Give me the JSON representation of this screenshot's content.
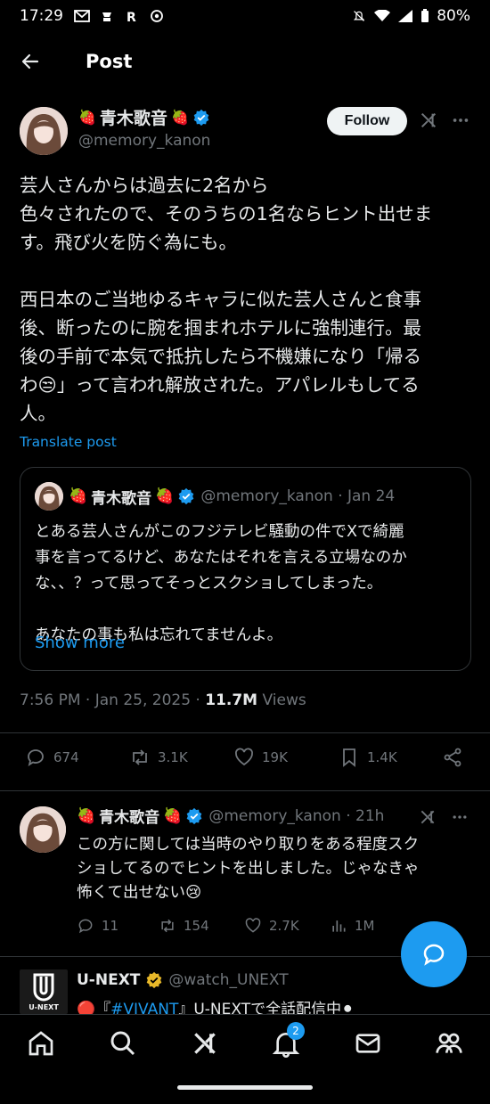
{
  "status_bar": {
    "time": "17:29",
    "battery": "80%"
  },
  "top_bar": {
    "title": "Post"
  },
  "post": {
    "display_name": "青木歌音",
    "strawberry": "🍓",
    "handle": "@memory_kanon",
    "follow_label": "Follow",
    "body": "芸人さんからは過去に2名から\n色々されたので、そのうちの1名ならヒント出せま\nす。飛び火を防ぐ為にも。\n\n西日本のご当地ゆるキャラに似た芸人さんと食事\n後、断ったのに腕を掴まれホテルに強制連行。最\n後の手前で本気で抵抗したら不機嫌になり「帰る\nわ😒」って言われ解放された。アパレルもしてる\n人。",
    "translate": "Translate post",
    "timestamp": "7:56 PM · Jan 25, 2025 · ",
    "views_count": "11.7M",
    "views_label": " Views",
    "stats": {
      "replies": "674",
      "reposts": "3.1K",
      "likes": "19K",
      "bookmarks": "1.4K"
    }
  },
  "quote": {
    "display_name": "青木歌音",
    "meta": "@memory_kanon · Jan 24",
    "text": "とある芸人さんがこのフジテレビ騒動の件でXで綺麗\n事を言ってるけど、あなたはそれを言える立場なのか\nな、、？って思ってそっとスクショしてしまった。\n\nあなたの事も私は忘れてませんよ。",
    "show_more": "Show more"
  },
  "reply": {
    "display_name": "青木歌音",
    "meta": "@memory_kanon · 21h",
    "text": "この方に関しては当時のやり取りをある程度スク\nショしてるのでヒントを出しました。じゃなきゃ\n怖くて出せない😢",
    "stats": {
      "replies": "11",
      "reposts": "154",
      "likes": "2.7K",
      "views": "1M"
    }
  },
  "ad": {
    "logo_text": "U-NEXT",
    "display_name": "U-NEXT",
    "handle": "@watch_UNEXT",
    "text_prefix": "🔴『",
    "link": "#VIVANT",
    "text_suffix": "』U-NEXTで全話配信中⚫"
  },
  "nav": {
    "notifications_badge": "2"
  },
  "colors": {
    "accent": "#1d9bf0",
    "muted": "#71767b",
    "text": "#e7e9ea",
    "verified": "#1d9bf0",
    "gold_verified": "#e8b829"
  }
}
